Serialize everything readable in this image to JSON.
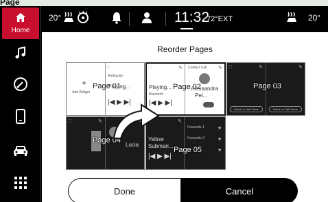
{
  "header_label": "Page",
  "sidebar": {
    "home_label": "Home"
  },
  "status": {
    "temp_left": "20°",
    "clock": "11:32",
    "ext_temp": "72°EXT",
    "temp_right": "20°"
  },
  "main": {
    "title": "Reorder Pages",
    "tiles": [
      {
        "label": "Page 01",
        "left_text": "Add Widget",
        "center_text": "Playing...",
        "small": "Ambiguity"
      },
      {
        "label": "Page 02",
        "left_text": "Playing...",
        "small_left": "Bluetooth",
        "contact_first": "Alessandra",
        "contact_last": "Pel...",
        "small_right": "Contact Call"
      },
      {
        "label": "Page 03",
        "left_btn": "Switch to Split Mode",
        "right_btn": "Switch to Split Mode"
      },
      {
        "label": "Page 04",
        "name": "Lucia"
      },
      {
        "label": "Page 05",
        "song_title": "Yellow",
        "song_artist": "Submari...",
        "fav1": "Favourite 1",
        "fav2": "Favourite 2"
      }
    ]
  },
  "buttons": {
    "done": "Done",
    "cancel": "Cancel"
  }
}
